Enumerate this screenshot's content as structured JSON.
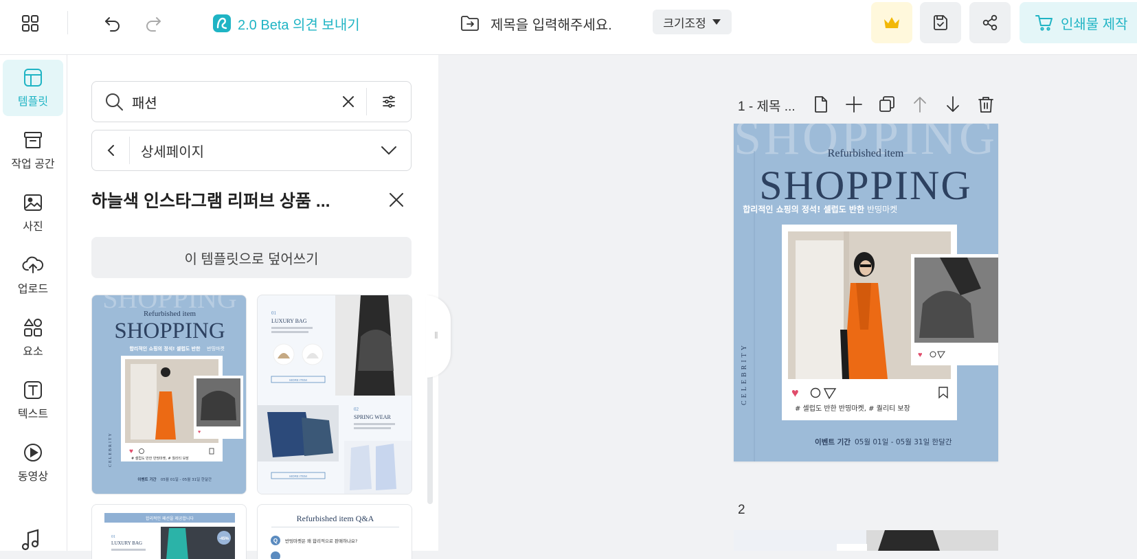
{
  "topbar": {
    "feedback_label": "2.0 Beta 의견 보내기",
    "doc_title_placeholder": "제목을 입력해주세요.",
    "resize_label": "크기조정",
    "print_label": "인쇄물 제작"
  },
  "sidebar": {
    "items": [
      {
        "label": "템플릿",
        "icon": "template-icon"
      },
      {
        "label": "작업 공간",
        "icon": "archive-icon"
      },
      {
        "label": "사진",
        "icon": "image-icon"
      },
      {
        "label": "업로드",
        "icon": "cloud-upload-icon"
      },
      {
        "label": "요소",
        "icon": "shapes-icon"
      },
      {
        "label": "텍스트",
        "icon": "text-icon"
      },
      {
        "label": "동영상",
        "icon": "play-icon"
      }
    ]
  },
  "panel": {
    "search_value": "패션",
    "category_label": "상세페이지",
    "template_title": "하늘색 인스타그램 리퍼브 상품 ...",
    "overwrite_label": "이 템플릿으로 덮어쓰기"
  },
  "thumbs": {
    "t1": {
      "bg": "SHOPPING",
      "sub": "Refurbished item",
      "big": "SHOPPING",
      "line": "합리적인 쇼핑의 정석! 셀럽도 반한",
      "line_hl": "반띵마켓",
      "tags": "# 셀럽도 반한 반띵마켓, # 퀄리티 보장",
      "event": "이벤트 기간",
      "dates": "05월 01일 - 05월 31일 한달간",
      "vertical": "CELEBRITY"
    },
    "t2": {
      "num1": "01",
      "h1": "LUXURY BAG",
      "num2": "02",
      "h2": "SPRING WEAR",
      "more": "MORE ITEM"
    },
    "t3": {
      "banner": "합리적인 패션을 제공합니다",
      "num": "01",
      "h": "LUXURY BAG",
      "badge": "-45%"
    },
    "t4": {
      "title": "Refurbished item Q&A",
      "q": "Q",
      "qtext": "반띵마켓은 왜 합리적으로 판매하나요?"
    }
  },
  "page1": {
    "label": "1 - 제목 ...",
    "bg_word": "SHOPPING",
    "sub": "Refurbished item",
    "big": "SHOPPING",
    "tagline": "합리적인 쇼핑의 정석! 셀럽도 반한",
    "tagline_hl": "반띵마켓",
    "hashtags": "# 셀럽도 반한 반띵마켓, # 퀄리티 보장",
    "event_label": "이벤트 기간",
    "event_dates": "05월 01일 - 05월 31일 한달간",
    "vertical": "CELEBRITY"
  },
  "page2": {
    "label": "2"
  },
  "colors": {
    "accent": "#1fb4c4",
    "card_blue": "#9dbbd8",
    "navy": "#2d4160",
    "orange": "#ec6a14",
    "crown_bg": "#fff8dc",
    "print_bg": "#e4f6f8"
  }
}
